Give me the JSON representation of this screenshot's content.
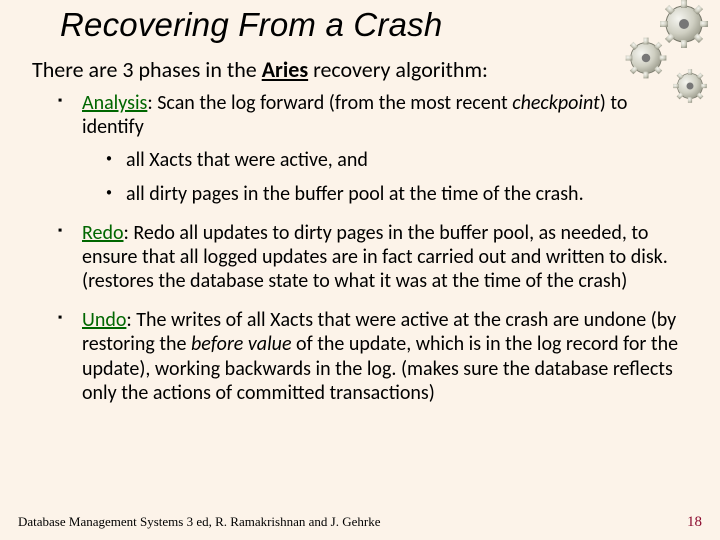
{
  "title": "Recovering From a Crash",
  "intro_pre": "There are 3 phases in the ",
  "intro_aries": "Aries",
  "intro_post": " recovery algorithm:",
  "phases": {
    "analysis": {
      "name": "Analysis",
      "aft1": ":  Scan the log forward (from the most recent ",
      "ital1": "checkpoint",
      "aft2": ") to identify",
      "sub1": "all Xacts that were active, and",
      "sub2": "all dirty pages in the buffer pool at the time of the crash."
    },
    "redo": {
      "name": "Redo",
      "text": ":  Redo all updates to dirty pages in the buffer pool, as needed, to ensure that all logged updates are in fact carried out and written to disk.   (restores the database state to what it was at the time of the crash)"
    },
    "undo": {
      "name": "Undo",
      "t1": ":  The  writes of all Xacts that were active at the crash are undone (by restoring the ",
      "ital1": "before value",
      "t2": " of the update, which is in the log record for the update), working backwards in the log.    (makes sure the database reflects only the actions of committed transactions)"
    }
  },
  "footer_left": "Database Management Systems 3 ed,  R. Ramakrishnan and J. Gehrke",
  "footer_right": "18"
}
